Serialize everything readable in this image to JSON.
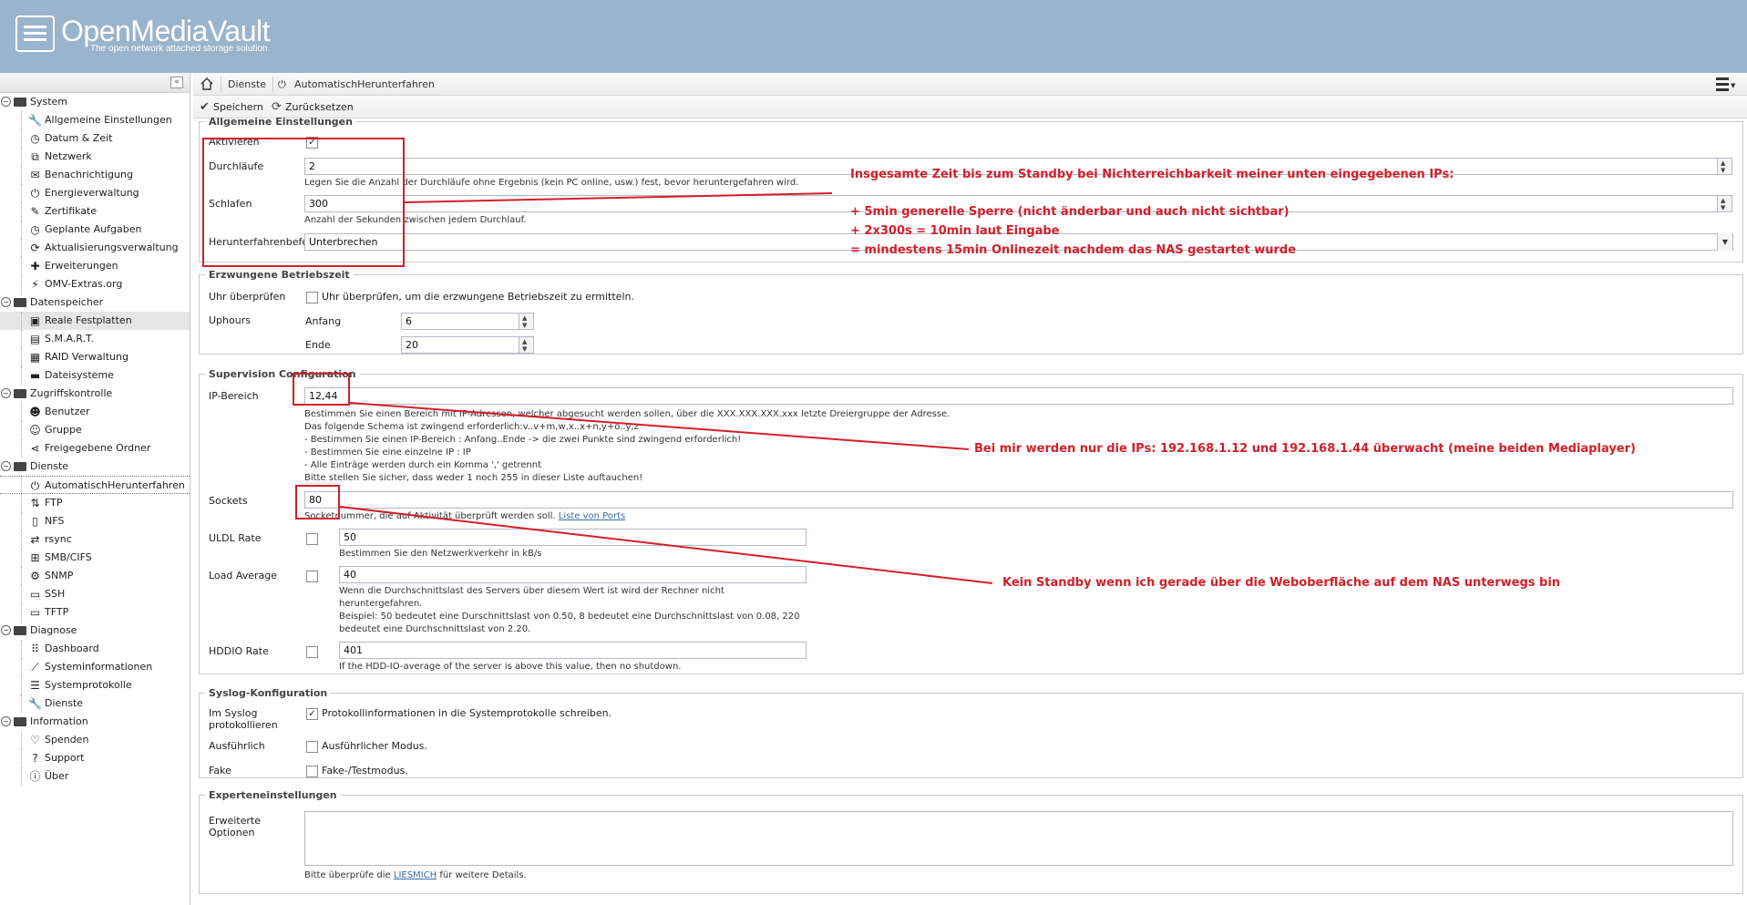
{
  "app": {
    "title": "OpenMediaVault",
    "tagline": "The open network attached storage solution"
  },
  "sidebar": {
    "collapse_icon": "double-chevron-left-icon",
    "groups": [
      {
        "label": "System",
        "items": [
          {
            "label": "Allgemeine Einstellungen",
            "icon": "wrench-icon"
          },
          {
            "label": "Datum & Zeit",
            "icon": "clock-icon"
          },
          {
            "label": "Netzwerk",
            "icon": "network-icon"
          },
          {
            "label": "Benachrichtigung",
            "icon": "envelope-icon"
          },
          {
            "label": "Energieverwaltung",
            "icon": "power-icon"
          },
          {
            "label": "Zertifikate",
            "icon": "certificate-icon"
          },
          {
            "label": "Geplante Aufgaben",
            "icon": "clock-icon"
          },
          {
            "label": "Aktualisierungsverwaltung",
            "icon": "refresh-icon"
          },
          {
            "label": "Erweiterungen",
            "icon": "puzzle-icon"
          },
          {
            "label": "OMV-Extras.org",
            "icon": "plug-icon"
          }
        ]
      },
      {
        "label": "Datenspeicher",
        "items": [
          {
            "label": "Reale Festplatten",
            "icon": "disk-icon"
          },
          {
            "label": "S.M.A.R.T.",
            "icon": "chart-icon"
          },
          {
            "label": "RAID Verwaltung",
            "icon": "raid-icon"
          },
          {
            "label": "Dateisysteme",
            "icon": "folder-icon"
          }
        ]
      },
      {
        "label": "Zugriffskontrolle",
        "items": [
          {
            "label": "Benutzer",
            "icon": "user-icon"
          },
          {
            "label": "Gruppe",
            "icon": "group-icon"
          },
          {
            "label": "Freigegebene Ordner",
            "icon": "share-icon"
          }
        ]
      },
      {
        "label": "Dienste",
        "items": [
          {
            "label": "AutomatischHerunterfahren",
            "icon": "power-icon"
          },
          {
            "label": "FTP",
            "icon": "ftp-icon"
          },
          {
            "label": "NFS",
            "icon": "nfs-icon"
          },
          {
            "label": "rsync",
            "icon": "rsync-icon"
          },
          {
            "label": "SMB/CIFS",
            "icon": "windows-icon"
          },
          {
            "label": "SNMP",
            "icon": "gear-icon"
          },
          {
            "label": "SSH",
            "icon": "terminal-icon"
          },
          {
            "label": "TFTP",
            "icon": "tftp-icon"
          }
        ]
      },
      {
        "label": "Diagnose",
        "items": [
          {
            "label": "Dashboard",
            "icon": "grid-icon"
          },
          {
            "label": "Systeminformationen",
            "icon": "line-chart-icon"
          },
          {
            "label": "Systemprotokolle",
            "icon": "log-icon"
          },
          {
            "label": "Dienste",
            "icon": "wrench-icon"
          }
        ]
      },
      {
        "label": "Information",
        "items": [
          {
            "label": "Spenden",
            "icon": "heart-icon"
          },
          {
            "label": "Support",
            "icon": "question-icon"
          },
          {
            "label": "Über",
            "icon": "info-icon"
          }
        ]
      }
    ]
  },
  "breadcrumb": {
    "items": [
      "Dienste",
      "AutomatischHerunterfahren"
    ]
  },
  "toolbar": {
    "save_label": "Speichern",
    "reset_label": "Zurücksetzen"
  },
  "general": {
    "legend": "Allgemeine Einstellungen",
    "aktivieren_label": "Aktivieren",
    "aktivieren_checked": true,
    "durchlaeufe_label": "Durchläufe",
    "durchlaeufe_value": "2",
    "durchlaeufe_hint": "Legen Sie die Anzahl der Durchläufe ohne Ergebnis (kein PC online, usw.) fest, bevor heruntergefahren wird.",
    "schlafen_label": "Schlafen",
    "schlafen_value": "300",
    "schlafen_hint": "Anzahl der Sekunden zwischen jedem Durchlauf.",
    "shutdown_label": "Herunterfahrenbefel",
    "shutdown_value": "Unterbrechen"
  },
  "forced": {
    "legend": "Erzwungene Betriebszeit",
    "uhr_label": "Uhr überprüfen",
    "uhr_text": "Uhr überprüfen, um die erzwungene Betriebszeit zu ermitteln.",
    "uphours_label": "Uphours",
    "anfang_label": "Anfang",
    "anfang_value": "6",
    "ende_label": "Ende",
    "ende_value": "20"
  },
  "supervision": {
    "legend": "Supervision Configuration",
    "ip_label": "IP-Bereich",
    "ip_value": "12,44",
    "ip_hints": [
      "Bestimmen Sie einen Bereich mit IP-Adressen, welcher abgesucht werden sollen, über die XXX.XXX.XXX.xxx letzte Dreiergruppe der Adresse.",
      "Das folgende Schema ist zwingend erforderlich:v..v+m,w,x..x+n,y+o..y,z",
      "- Bestimmen Sie einen IP-Bereich : Anfang..Ende -> die zwei Punkte sind zwingend erforderlich!",
      "- Bestimmen Sie eine einzelne IP : IP",
      "- Alle Einträge werden durch ein Komma ',' getrennt",
      "Bitte stellen Sie sicher, dass weder 1 noch 255 in dieser Liste auftauchen!"
    ],
    "sockets_label": "Sockets",
    "sockets_value": "80",
    "sockets_hint": "Socketnummer, die auf Aktivität überprüft werden soll.",
    "sockets_link": "Liste von Ports",
    "uldl_label": "ULDL Rate",
    "uldl_value": "50",
    "uldl_hint": "Bestimmen Sie den Netzwerkverkehr in kB/s",
    "load_label": "Load Average",
    "load_value": "40",
    "load_hints": [
      "Wenn die Durchschnittslast des Servers über diesem Wert ist wird der Rechner nicht",
      "heruntergefahren.",
      "Beispiel: 50 bedeutet eine Durschnittslast von 0.50, 8 bedeutet eine Durchschnittslast von 0.08, 220",
      "bedeutet eine Durchschnittslast von 2.20."
    ],
    "hddio_label": "HDDIO Rate",
    "hddio_value": "401",
    "hddio_hint": "If the HDD-IO-average of the server is above this value, then no shutdown."
  },
  "syslog": {
    "legend": "Syslog-Konfiguration",
    "im_syslog_label_1": "Im Syslog",
    "im_syslog_label_2": "protokollieren",
    "im_syslog_text": "Protokollinformationen in die Systemprotokolle schreiben.",
    "im_syslog_checked": true,
    "verbose_label": "Ausführlich",
    "verbose_text": "Ausführlicher Modus.",
    "fake_label": "Fake",
    "fake_text": "Fake-/Testmodus."
  },
  "expert": {
    "legend": "Experteneinstellungen",
    "options_label_1": "Erweiterte",
    "options_label_2": "Optionen",
    "hint_pre": "Bitte überprüfe die",
    "hint_link": "LIESMICH",
    "hint_post": "für weitere Details."
  },
  "annotations": {
    "color": "#d21f2a",
    "line1": "Insgesamte Zeit bis zum Standby bei Nichterreichbarkeit meiner unten eingegebenen IPs:",
    "line2": "+ 5min generelle Sperre (nicht änderbar und auch nicht sichtbar)",
    "line3": "+ 2x300s = 10min laut Eingabe",
    "line4": "= mindestens 15min Onlinezeit nachdem das NAS gestartet wurde",
    "ip_note": "Bei mir werden nur die IPs: 192.168.1.12 und 192.168.1.44 überwacht (meine beiden Mediaplayer)",
    "socket_note": "Kein Standby wenn ich gerade über die Weboberfläche auf dem NAS unterwegs bin"
  }
}
